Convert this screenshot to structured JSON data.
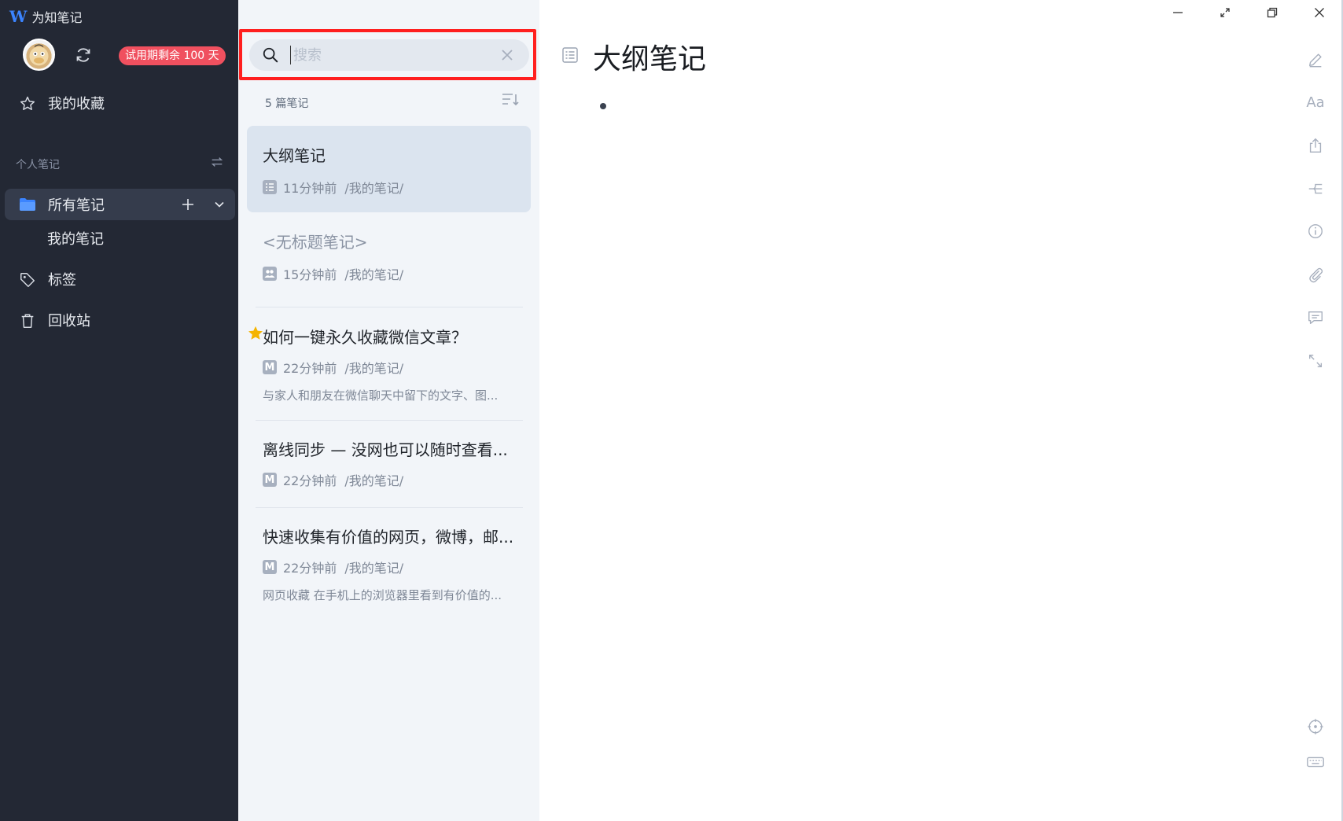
{
  "app": {
    "logo": "W",
    "name": "为知笔记"
  },
  "sidebar": {
    "trial_badge": "试用期剩余 100 天",
    "favorites": "我的收藏",
    "section_label": "个人笔记",
    "all_notes": "所有笔记",
    "sub_item": "我的笔记",
    "tags": "标签",
    "trash": "回收站"
  },
  "search": {
    "placeholder": "搜索",
    "value": ""
  },
  "notelist": {
    "count": "5 篇笔记",
    "notes": [
      {
        "title": "大纲笔记",
        "type": "outline",
        "time": "11分钟前",
        "path": "/我的笔记/",
        "snippet": "",
        "selected": true,
        "starred": false
      },
      {
        "title": "<无标题笔记>",
        "type": "collab",
        "time": "15分钟前",
        "path": "/我的笔记/",
        "snippet": "",
        "selected": false,
        "starred": false
      },
      {
        "title": "如何一键永久收藏微信文章？",
        "type": "markdown",
        "type_glyph": "M",
        "time": "22分钟前",
        "path": "/我的笔记/",
        "snippet": "与家人和朋友在微信聊天中留下的文字、图...",
        "selected": false,
        "starred": true
      },
      {
        "title": "离线同步 — 没网也可以随时查看...",
        "type": "markdown",
        "type_glyph": "M",
        "time": "22分钟前",
        "path": "/我的笔记/",
        "snippet": "",
        "selected": false,
        "starred": false
      },
      {
        "title": "快速收集有价值的网页，微博，邮...",
        "type": "markdown",
        "type_glyph": "M",
        "time": "22分钟前",
        "path": "/我的笔记/",
        "snippet": "网页收藏 在手机上的浏览器里看到有价值的...",
        "selected": false,
        "starred": false
      }
    ]
  },
  "editor": {
    "title": "大纲笔记",
    "font_tool_label": "Aa"
  },
  "colors": {
    "sidebar_bg": "#232834",
    "accent_blue": "#3b84ff",
    "badge_red": "#f0505f",
    "highlight_red": "#ff1f1f",
    "star_yellow": "#f5b400",
    "list_bg": "#f2f5f9",
    "selected_bg": "#dbe4ef"
  }
}
